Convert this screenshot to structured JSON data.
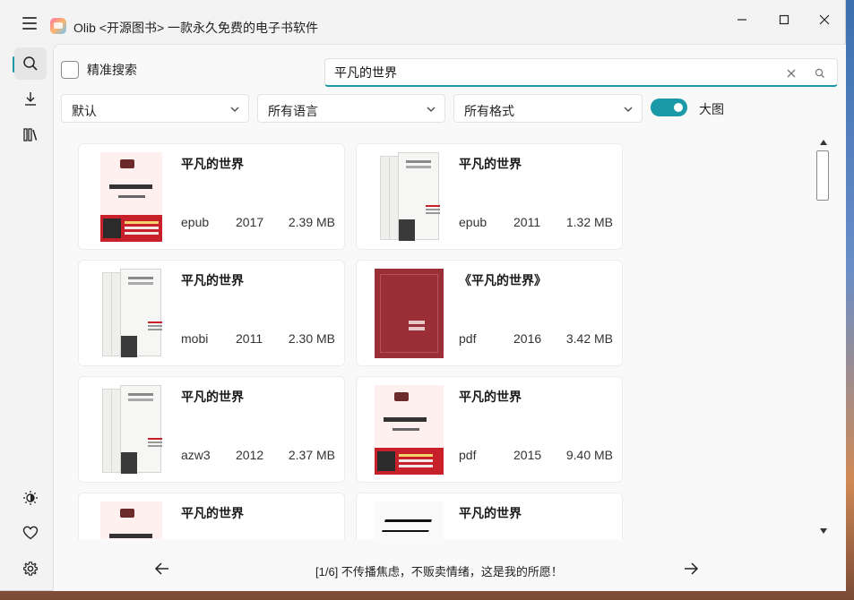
{
  "app": {
    "title": "Olib <开源图书> 一款永久免费的电子书软件"
  },
  "sidebar": {
    "items": [
      {
        "icon": "search-icon",
        "active": true
      },
      {
        "icon": "download-icon",
        "active": false
      },
      {
        "icon": "library-icon",
        "active": false
      }
    ],
    "bottom": [
      {
        "icon": "theme-icon"
      },
      {
        "icon": "heart-icon"
      },
      {
        "icon": "gear-icon"
      }
    ]
  },
  "search": {
    "precise_label": "精准搜索",
    "query": "平凡的世界"
  },
  "filters": {
    "sort": "默认",
    "language": "所有语言",
    "format": "所有格式",
    "large_view_label": "大图",
    "large_view_on": true
  },
  "results": [
    {
      "title": "平凡的世界",
      "format": "epub",
      "year": "2017",
      "size": "2.39 MB",
      "cover": "red"
    },
    {
      "title": "平凡的世界",
      "format": "epub",
      "year": "2011",
      "size": "1.32 MB",
      "cover": "box"
    },
    {
      "title": "平凡的世界",
      "format": "mobi",
      "year": "2011",
      "size": "2.30 MB",
      "cover": "box"
    },
    {
      "title": "《平凡的世界》",
      "format": "pdf",
      "year": "2016",
      "size": "3.42 MB",
      "cover": "maroon"
    },
    {
      "title": "平凡的世界",
      "format": "azw3",
      "year": "2012",
      "size": "2.37 MB",
      "cover": "box"
    },
    {
      "title": "平凡的世界",
      "format": "pdf",
      "year": "2015",
      "size": "9.40 MB",
      "cover": "red"
    },
    {
      "title": "平凡的世界",
      "format": "",
      "year": "",
      "size": "",
      "cover": "red"
    },
    {
      "title": "平凡的世界",
      "format": "",
      "year": "",
      "size": "",
      "cover": "calli"
    }
  ],
  "pager": {
    "text": "[1/6] 不传播焦虑，不贩卖情绪，这是我的所愿！"
  },
  "colors": {
    "accent": "#1a9aa6",
    "window_bg": "#f3f3f3",
    "card_bg": "#ffffff"
  }
}
